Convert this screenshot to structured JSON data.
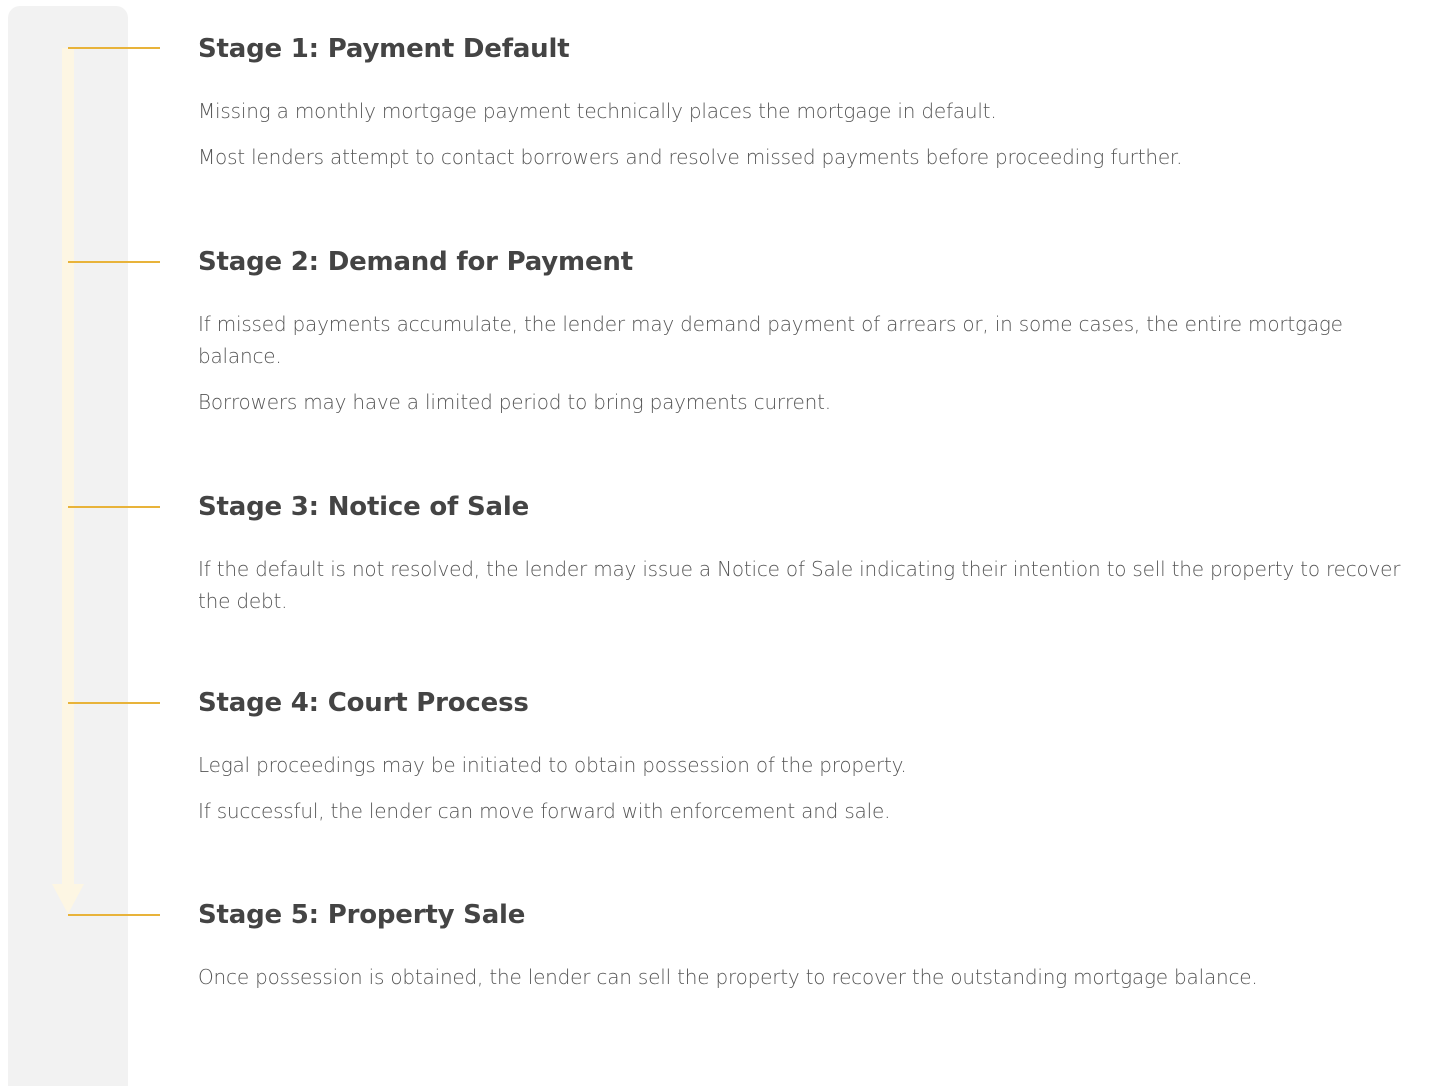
{
  "colors": {
    "panel": "#f2f2f2",
    "accent_line": "#e8b33a",
    "arrow": "#fdf6e3",
    "title_text": "#444444",
    "body_text": "#555555"
  },
  "stages": [
    {
      "title": "Stage 1: Payment Default",
      "paragraphs": [
        "Missing a monthly mortgage payment technically places the mortgage in default.",
        "Most lenders attempt to contact borrowers and resolve missed payments before proceeding further."
      ]
    },
    {
      "title": "Stage 2: Demand for Payment",
      "paragraphs": [
        "If missed payments accumulate, the lender may demand payment of arrears or, in some cases, the entire mortgage balance.",
        "Borrowers may have a limited period to bring payments current."
      ]
    },
    {
      "title": "Stage 3: Notice of Sale",
      "paragraphs": [
        "If the default is not resolved, the lender may issue a Notice of Sale indicating their intention to sell the property to recover the debt."
      ]
    },
    {
      "title": "Stage 4: Court Process",
      "paragraphs": [
        "Legal proceedings may be initiated to obtain possession of the property.",
        "If successful, the lender can move forward with enforcement and sale."
      ]
    },
    {
      "title": "Stage 5: Property Sale",
      "paragraphs": [
        "Once possession is obtained, the lender can sell the property to recover the outstanding mortgage balance."
      ]
    }
  ]
}
